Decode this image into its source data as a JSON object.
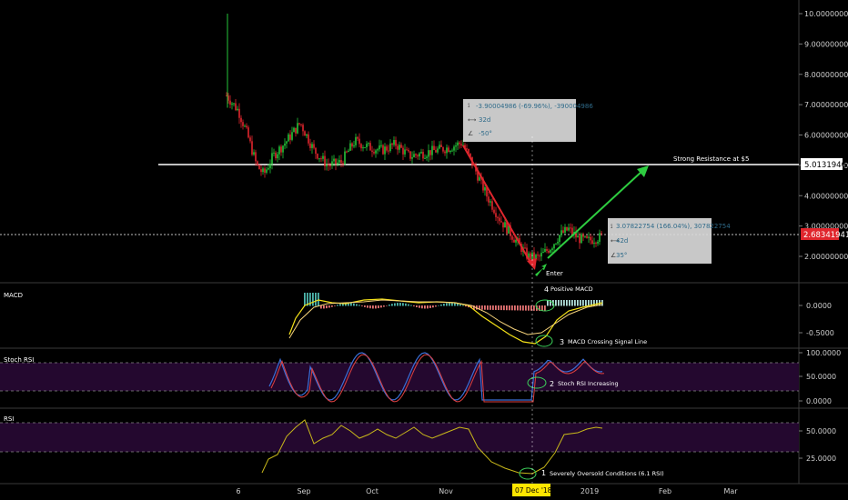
{
  "chart_data": [
    {
      "type": "candlestick",
      "panel": "price",
      "y_range": [
        1.2,
        10.2
      ],
      "y_ticks": [
        {
          "value": 10,
          "label": "10.00000000"
        },
        {
          "value": 9,
          "label": "9.00000000"
        },
        {
          "value": 8,
          "label": "8.00000000"
        },
        {
          "value": 7,
          "label": "7.00000000"
        },
        {
          "value": 6,
          "label": "6.00000000"
        },
        {
          "value": 5,
          "label": "5.00000000"
        },
        {
          "value": 4,
          "label": "4.00000000"
        },
        {
          "value": 3,
          "label": "3.00000000"
        },
        {
          "value": 2,
          "label": "2.00000000"
        }
      ],
      "resistance": {
        "value": 5.01319461,
        "label": "5.01319461",
        "text": "Strong Resistance at $5"
      },
      "current_price": {
        "value": 2.68341941,
        "label": "2.68341941"
      },
      "candles_approx": [
        {
          "x": 0.0,
          "close": 7.3
        },
        {
          "x": 0.3,
          "close": 6.8
        },
        {
          "x": 0.6,
          "close": 6.2
        },
        {
          "x": 1.0,
          "close": 5.6
        },
        {
          "x": 1.5,
          "close": 5.0
        },
        {
          "x": 2.0,
          "close": 4.6
        },
        {
          "x": 2.5,
          "close": 5.3
        },
        {
          "x": 3.0,
          "close": 5.9
        },
        {
          "x": 3.5,
          "close": 6.4
        },
        {
          "x": 4.0,
          "close": 5.5
        },
        {
          "x": 4.5,
          "close": 5.0
        },
        {
          "x": 5.0,
          "close": 5.2
        },
        {
          "x": 5.5,
          "close": 5.8
        },
        {
          "x": 6.0,
          "close": 5.6
        },
        {
          "x": 6.5,
          "close": 5.4
        },
        {
          "x": 7.0,
          "close": 5.7
        },
        {
          "x": 7.5,
          "close": 5.3
        },
        {
          "x": 8.0,
          "close": 5.4
        },
        {
          "x": 8.5,
          "close": 5.5
        },
        {
          "x": 9.0,
          "close": 5.75
        },
        {
          "x": 9.5,
          "close": 4.6
        },
        {
          "x": 10.0,
          "close": 3.4
        },
        {
          "x": 10.5,
          "close": 2.6
        },
        {
          "x": 11.0,
          "close": 1.9
        },
        {
          "x": 11.5,
          "close": 2.1
        },
        {
          "x": 12.0,
          "close": 2.5
        },
        {
          "x": 12.5,
          "close": 2.8
        },
        {
          "x": 13.0,
          "close": 2.6
        },
        {
          "x": 13.5,
          "close": 2.65
        }
      ],
      "annotations": [
        {
          "kind": "measure-down",
          "price_range": "-3.90004986 (-69.96%), -390004986",
          "bars": "32d",
          "angle": "-50°"
        },
        {
          "kind": "measure-up",
          "price_range": "3.07822754 (166.04%), 307822754",
          "bars": "42d",
          "angle": "35°"
        },
        {
          "kind": "label",
          "text": "Enter"
        }
      ]
    },
    {
      "type": "line",
      "panel": "MACD",
      "title": "MACD",
      "y_ticks": [
        {
          "value": 0,
          "label": "0.0000"
        },
        {
          "value": -0.5,
          "label": "-0.5000"
        }
      ],
      "annotations": [
        {
          "number": "4",
          "text": "Positive MACD"
        },
        {
          "number": "3",
          "text": "MACD Crossing Signal Line"
        }
      ]
    },
    {
      "type": "line",
      "panel": "Stoch RSI",
      "title": "Stoch RSI",
      "y_ticks": [
        {
          "value": 100,
          "label": "100.0000"
        },
        {
          "value": 50,
          "label": "50.0000"
        },
        {
          "value": 0,
          "label": "0.0000"
        }
      ],
      "annotations": [
        {
          "number": "2",
          "text": "Stoch RSI Increasing"
        }
      ]
    },
    {
      "type": "line",
      "panel": "RSI",
      "title": "RSI",
      "y_ticks": [
        {
          "value": 50,
          "label": "50.0000"
        },
        {
          "value": 25,
          "label": "25.0000"
        }
      ],
      "annotations": [
        {
          "number": "1",
          "text": "Severely Oversold Conditions (6.1 RSI)"
        }
      ]
    }
  ],
  "x_axis": {
    "ticks": [
      "6",
      "Sep",
      "Oct",
      "Nov",
      "2019",
      "Feb",
      "Mar"
    ],
    "cursor_label": "07 Dec '18"
  },
  "colors": {
    "background": "#000000",
    "bull": "#26c63a",
    "bear": "#e0262d",
    "macd_line": "#f5e218",
    "signal_line": "#f5d27a",
    "stoch_k": "#3a6fd8",
    "stoch_d": "#e04040",
    "rsi_line": "#c8b81a",
    "band": "#2a0a3a",
    "arrow_down": "#e0262d",
    "arrow_up": "#2ecc40",
    "annotation_circle": "#3cd25a",
    "label_red": "#e0262d",
    "cursor_label_bg": "#ffe600"
  }
}
